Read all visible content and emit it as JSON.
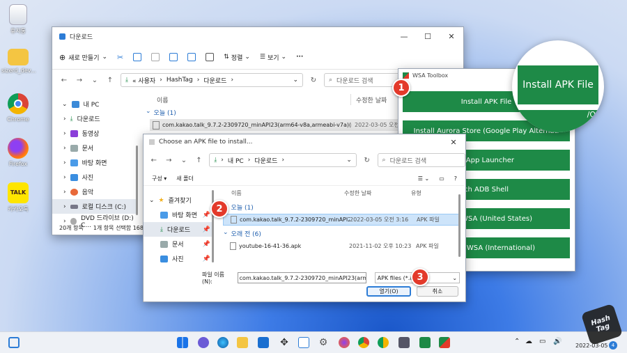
{
  "desktop": {
    "icons": [
      {
        "label": "휴지통"
      },
      {
        "label": "sizerd_dev..."
      },
      {
        "label": "Chrome"
      },
      {
        "label": "Firefox"
      },
      {
        "label": "카카오톡"
      }
    ]
  },
  "explorer": {
    "title": "다운로드",
    "toolbar": {
      "new": "새로 만들기",
      "sort": "정렬",
      "view": "보기",
      "more": "···"
    },
    "breadcrumb": [
      "« 사용자",
      "HashTag",
      "다운로드"
    ],
    "search_placeholder": "다운로드 검색",
    "col_name": "이름",
    "col_date": "수정한 날짜",
    "group_today": "오늘 (1)",
    "file_name": "com.kakao.talk_9.7.2-2309720_minAPI23(arm64-v8a,armeabi-v7a)(nodpi)...",
    "file_date": "2022-03-05 오전",
    "sidebar": [
      "내 PC",
      "다운로드",
      "동영상",
      "문서",
      "바탕 화면",
      "사진",
      "음악",
      "로컬 디스크 (C:)",
      "DVD 드라이브 (D:) C..."
    ],
    "status_count": "20개 항목",
    "status_selected": "1개 항목 선택함 168"
  },
  "wsa": {
    "title": "WSA Toolbox",
    "buttons": [
      "Install APK File",
      "Install Aurora Store (Google Play Alternative)",
      "Install App Launcher",
      "Launch ADB Shell",
      "WSA (United States)",
      "WSA (International)"
    ],
    "buttons_visible": [
      "Install APK File",
      "Install Aurora Store (Google Play Alternati",
      "tall App Launcher",
      "unch ADB Shell",
      "WSA (United States)",
      "WSA (International)"
    ],
    "zoom_label": "Install APK File",
    "zoom_partial": "/Q"
  },
  "dialog": {
    "title": "Choose an APK file to install...",
    "breadcrumb": [
      "내 PC",
      "다운로드"
    ],
    "search_placeholder": "다운로드 검색",
    "organize": "구성 ▾",
    "new_folder": "새 폴더",
    "col_name": "이름",
    "col_date": "수정한 날짜",
    "col_type": "유형",
    "group_today": "오늘 (1)",
    "group_old": "오래 전 (6)",
    "files": [
      {
        "name": "com.kakao.talk_9.7.2-2309720_minAPI2...",
        "date": "2022-03-05 오전 3:16",
        "type": "APK 파일"
      },
      {
        "name": "youtube-16-41-36.apk",
        "date": "2021-11-02 오후 10:23",
        "type": "APK 파일"
      }
    ],
    "sidebar": [
      "즐겨찾기",
      "바탕 화면",
      "다운로드",
      "문서",
      "사진"
    ],
    "filename_label": "파일 이름(N):",
    "filename_value": "com.kakao.talk_9.7.2-2309720_minAPI23(arm6",
    "filter_value": "APK files (*.apk",
    "open": "열기(O)",
    "cancel": "취소"
  },
  "steps": [
    "1",
    "2",
    "3"
  ],
  "taskbar": {
    "date": "2022-03-05",
    "notif": "4"
  },
  "watermark": {
    "line1": "Hash",
    "line2": "Tag"
  },
  "colors": {
    "accent_green": "#1e8a47",
    "badge_red": "#e33a2b",
    "select_blue": "#cde4fa"
  }
}
